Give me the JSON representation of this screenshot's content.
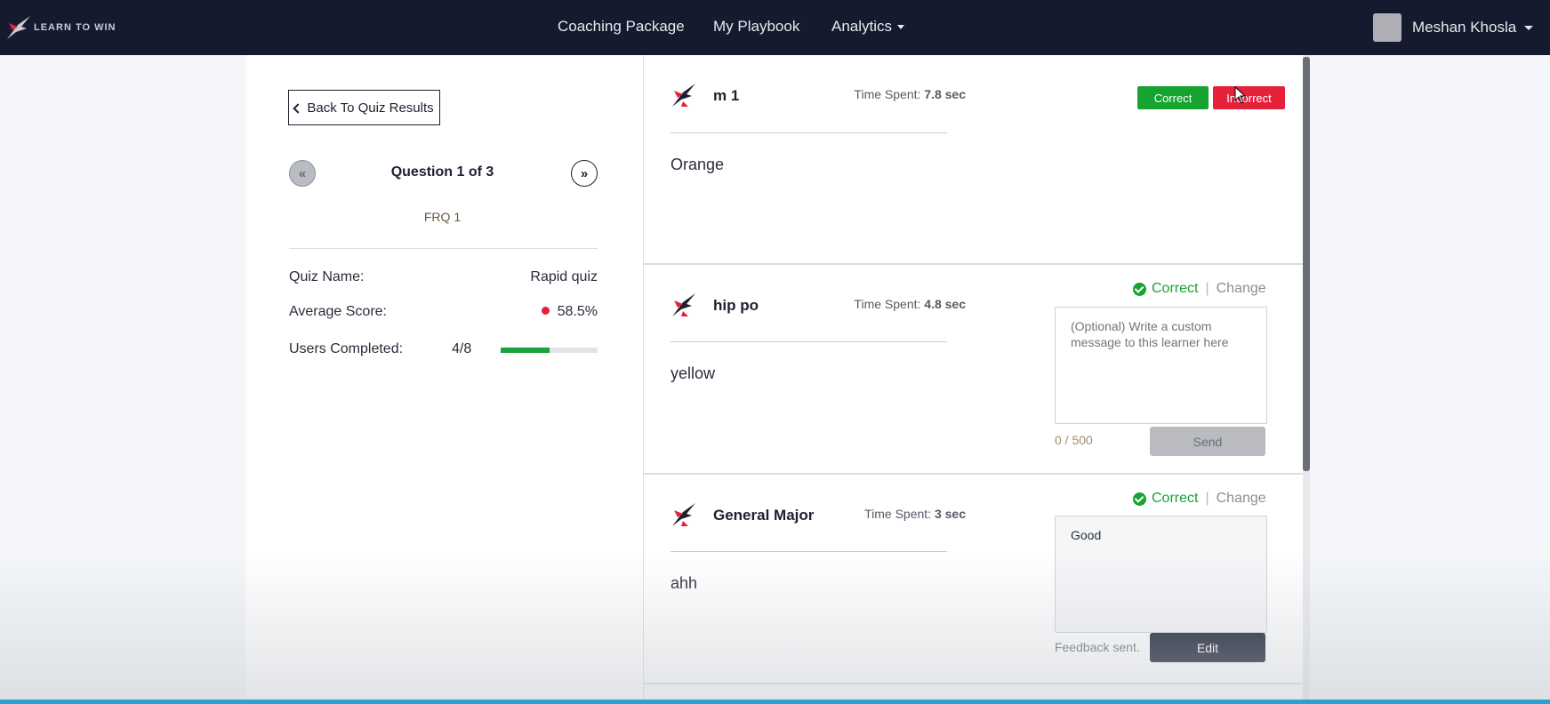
{
  "header": {
    "logo_text": "LEARN TO WIN",
    "nav": [
      "Coaching Package",
      "My Playbook",
      "Analytics"
    ],
    "user_name": "Meshan Khosla"
  },
  "left": {
    "back_label": "Back To Quiz Results",
    "prev_icon": "«",
    "next_icon": "»",
    "question_title": "Question 1 of 3",
    "question_name": "FRQ 1",
    "quiz_name_label": "Quiz Name:",
    "quiz_name_value": "Rapid quiz",
    "avg_score_label": "Average Score:",
    "avg_score_value": "58.5%",
    "users_completed_label": "Users Completed:",
    "users_completed_value": "4/8",
    "users_completed_fraction": 0.5
  },
  "responses": [
    {
      "name": "m 1",
      "time_label": "Time Spent:",
      "time_value": "7.8 sec",
      "answer": "Orange",
      "correct_label": "Correct",
      "incorrect_label": "Incorrect"
    },
    {
      "name": "hip po",
      "time_label": "Time Spent:",
      "time_value": "4.8 sec",
      "answer": "yellow",
      "status": "Correct",
      "change_label": "Change",
      "message_placeholder": "(Optional) Write a custom message to this learner here",
      "char_count": "0 / 500",
      "send_label": "Send"
    },
    {
      "name": "General Major",
      "time_label": "Time Spent:",
      "time_value": "3 sec",
      "answer": "ahh",
      "status": "Correct",
      "change_label": "Change",
      "message": "Good",
      "feedback_status": "Feedback sent.",
      "edit_label": "Edit"
    }
  ],
  "colors": {
    "nav_bg": "#151a2e",
    "correct": "#16a330",
    "incorrect": "#e5213a",
    "progress": "#1aa33c"
  }
}
